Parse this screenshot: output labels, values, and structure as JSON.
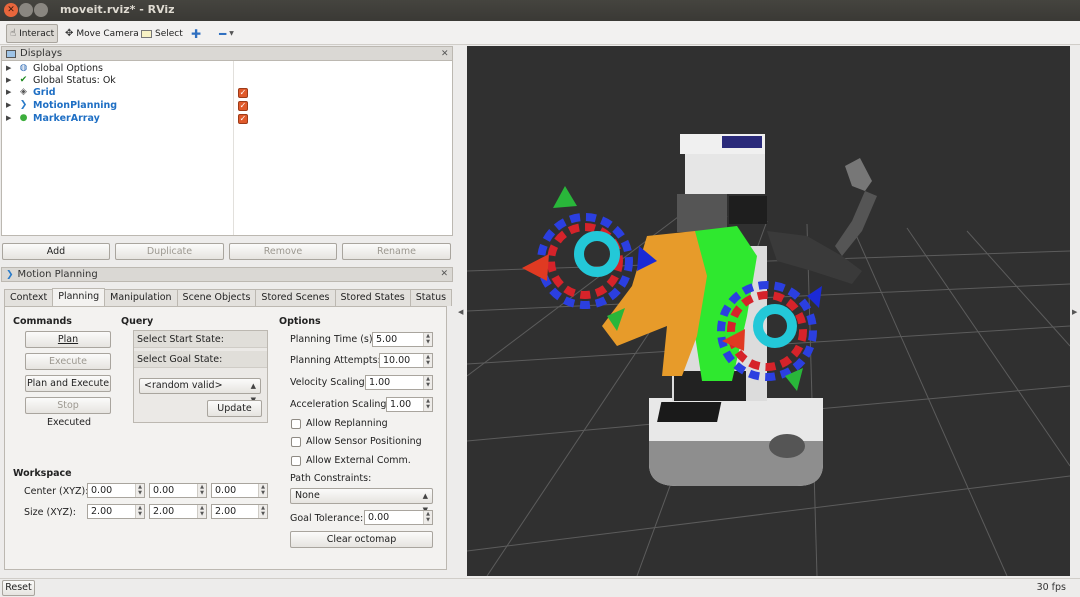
{
  "window": {
    "title": "moveit.rviz* - RViz"
  },
  "toolbar": {
    "interact": "Interact",
    "move_camera": "Move Camera",
    "select": "Select"
  },
  "displays": {
    "header": "Displays",
    "items": [
      {
        "label": "Global Options",
        "icon": "globe-icon"
      },
      {
        "label": "Global Status: Ok",
        "icon": "check-icon"
      },
      {
        "label": "Grid",
        "icon": "grid-icon",
        "checked": true
      },
      {
        "label": "MotionPlanning",
        "icon": "motion-planning-icon",
        "checked": true
      },
      {
        "label": "MarkerArray",
        "icon": "marker-array-icon",
        "checked": true
      }
    ],
    "buttons": {
      "add": "Add",
      "duplicate": "Duplicate",
      "remove": "Remove",
      "rename": "Rename"
    }
  },
  "motion_planning": {
    "header": "Motion Planning",
    "tabs": [
      "Context",
      "Planning",
      "Manipulation",
      "Scene Objects",
      "Stored Scenes",
      "Stored States",
      "Status"
    ],
    "commands": {
      "title": "Commands",
      "plan": "Plan",
      "execute": "Execute",
      "plan_and_execute": "Plan and Execute",
      "stop": "Stop",
      "status": "Executed"
    },
    "query": {
      "title": "Query",
      "select_start": "Select Start State:",
      "select_goal": "Select Goal State:",
      "goal_combo": "<random valid>",
      "update": "Update"
    },
    "options": {
      "title": "Options",
      "planning_time_label": "Planning Time (s):",
      "planning_time": "5.00",
      "planning_attempts_label": "Planning Attempts:",
      "planning_attempts": "10.00",
      "velocity_scaling_label": "Velocity Scaling:",
      "velocity_scaling": "1.00",
      "acceleration_scaling_label": "Acceleration Scaling:",
      "acceleration_scaling": "1.00",
      "allow_replanning": "Allow Replanning",
      "allow_sensor_positioning": "Allow Sensor Positioning",
      "allow_external_comm": "Allow External Comm.",
      "path_constraints_label": "Path Constraints:",
      "path_constraints": "None",
      "goal_tolerance_label": "Goal Tolerance:",
      "goal_tolerance": "0.00",
      "clear_octomap": "Clear octomap"
    },
    "workspace": {
      "title": "Workspace",
      "center_label": "Center (XYZ):",
      "center": [
        "0.00",
        "0.00",
        "0.00"
      ],
      "size_label": "Size (XYZ):",
      "size": [
        "2.00",
        "2.00",
        "2.00"
      ]
    }
  },
  "statusbar": {
    "reset": "Reset",
    "fps": "30 fps"
  },
  "colors": {
    "accent_orange": "#e05a2b",
    "link_blue": "#1f6fc4",
    "viewport_bg": "#303030"
  }
}
